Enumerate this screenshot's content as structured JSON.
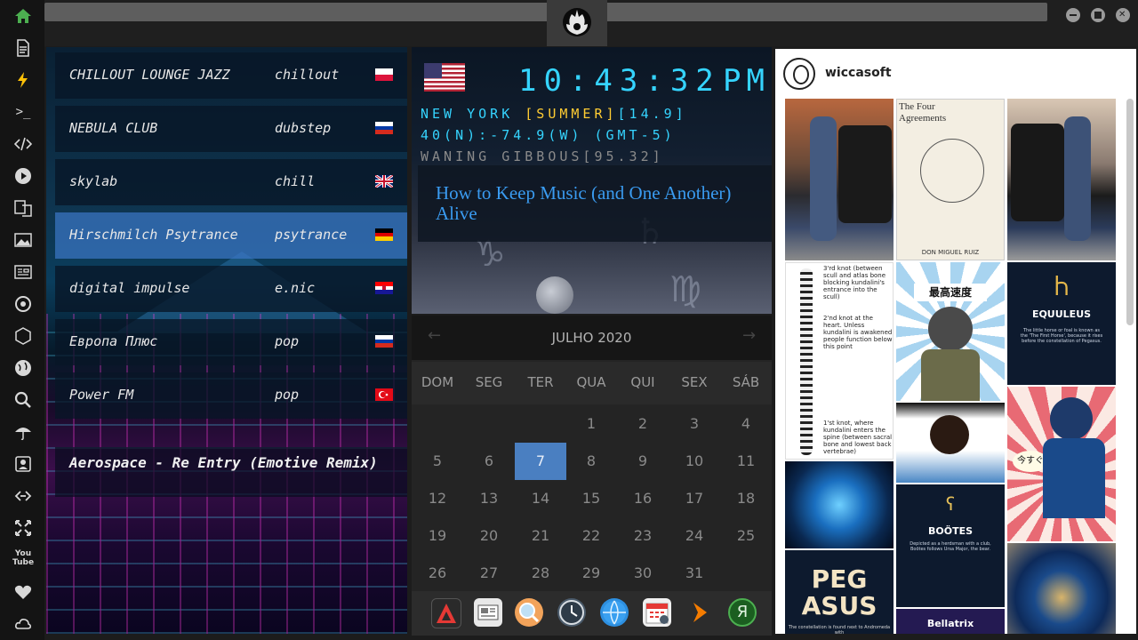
{
  "sidebar": {
    "icons": [
      "home-icon",
      "document-icon",
      "lightning-icon",
      "terminal-icon",
      "code-icon",
      "play-icon",
      "translate-icon",
      "image-icon",
      "news-icon",
      "settings-icon",
      "cube-icon",
      "globe-icon",
      "search-icon",
      "umbrella-icon",
      "contact-icon",
      "link-icon",
      "fullscreen-icon",
      "youtube-icon",
      "heart-icon",
      "cloud-icon"
    ],
    "accent": "#4caf50",
    "terminal_label": ">_",
    "youtube_label": "You\nTube"
  },
  "radio": {
    "stations": [
      {
        "name": "CHILLOUT LOUNGE JAZZ",
        "genre": "chillout",
        "flag": "poland-flag"
      },
      {
        "name": "NEBULA CLUB",
        "genre": "dubstep",
        "flag": "russia-flag"
      },
      {
        "name": "skylab",
        "genre": "chill",
        "flag": "uk-flag"
      },
      {
        "name": "Hirschmilch Psytrance",
        "genre": "psytrance",
        "flag": "germany-flag"
      },
      {
        "name": "digital impulse",
        "genre": "e.nic",
        "flag": "croatia-flag"
      },
      {
        "name": "Европа Плюс",
        "genre": "pop",
        "flag": "russia-flag"
      },
      {
        "name": "Power FM",
        "genre": "pop",
        "flag": "turkey-flag"
      }
    ],
    "now_playing": "Aerospace - Re Entry (Emotive Remix)"
  },
  "clock": {
    "time": "10:43:32",
    "ampm": "PM",
    "city": "NEW YORK",
    "season": "[SUMMER]",
    "temp": "[14.9]",
    "coords": "40(N):-74.9(W) (GMT-5)",
    "moon": "WANING GIBBOUS[95.32]",
    "quote": "How to Keep Music (and One Another) Alive"
  },
  "calendar": {
    "title": "JULHO 2020",
    "day_names": [
      "DOM",
      "SEG",
      "TER",
      "QUA",
      "QUI",
      "SEX",
      "SÁB"
    ],
    "weeks": [
      [
        "",
        "",
        "",
        "1",
        "2",
        "3",
        "4"
      ],
      [
        "5",
        "6",
        "7",
        "8",
        "9",
        "10",
        "11"
      ],
      [
        "12",
        "13",
        "14",
        "15",
        "16",
        "17",
        "18"
      ],
      [
        "19",
        "20",
        "21",
        "22",
        "23",
        "24",
        "25"
      ],
      [
        "26",
        "27",
        "28",
        "29",
        "30",
        "31",
        ""
      ]
    ],
    "today": "7",
    "prev_arrow": "←",
    "next_arrow": "→"
  },
  "dock": {
    "apps": [
      "anydesk-icon",
      "news-icon",
      "search-app-icon",
      "clock-app-icon",
      "browser-icon",
      "calendar-app-icon",
      "forward-icon",
      "yandex-icon"
    ],
    "yandex_label": "Я"
  },
  "instagram": {
    "username": "wiccasoft",
    "posts": [
      {
        "name": "photo-car-1",
        "text": ""
      },
      {
        "name": "book-four-agreements",
        "text": "The Four\nAgreements",
        "subtext": "DON MIGUEL RUIZ"
      },
      {
        "name": "photo-car-2",
        "text": ""
      },
      {
        "name": "kundalini-spine",
        "text": "3'rd knot (between scull and atlas bone blocking kundalini's entrance into the scull)",
        "text2": "2'nd knot at the heart. Unless kundalini is awakened people function below this point",
        "text3": "1'st knot, where kundalini enters the spine (between sacral bone and lowest back vertebrae)"
      },
      {
        "name": "anime-character-1",
        "text": "最高速度"
      },
      {
        "name": "equuleus-card",
        "text": "EQUULEUS",
        "subtext": "The little horse or foal is known as the 'The First Horse', because it rises before the constellation of Pegasus."
      },
      {
        "name": "anime-character-2",
        "text": ""
      },
      {
        "name": "anime-character-3",
        "text": "今すぐ"
      },
      {
        "name": "blue-tech-image",
        "text": ""
      },
      {
        "name": "bootes-card",
        "text": "BOÖTES",
        "subtext": "Depicted as a herdsman with a club, Boötes follows Ursa Major, the bear."
      },
      {
        "name": "pegasus-card",
        "text": "PEG\nASUS",
        "subtext": "The constellation is found next to Andromeda with"
      },
      {
        "name": "bellatrix-card",
        "text": "Bellatrix"
      },
      {
        "name": "astronomical-clock",
        "text": ""
      }
    ]
  },
  "window": {
    "buttons": [
      "minimize-button",
      "maximize-button",
      "close-button"
    ]
  }
}
